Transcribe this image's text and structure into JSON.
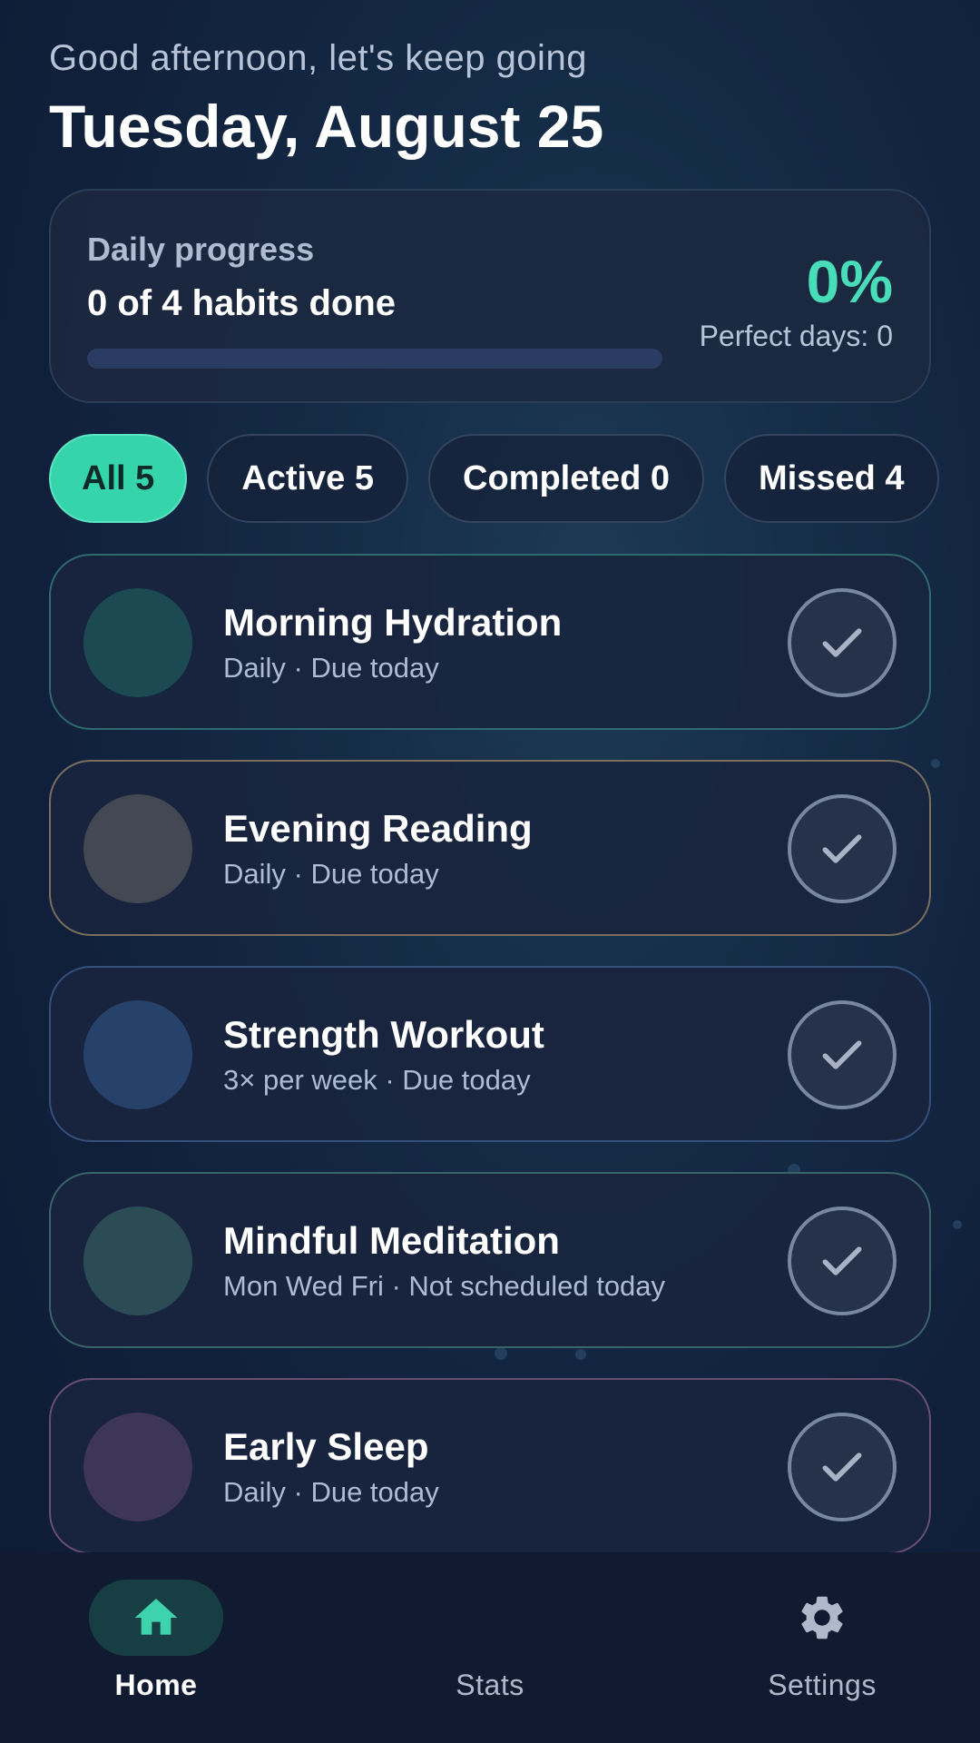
{
  "header": {
    "greeting": "Good afternoon, let's keep going",
    "date": "Tuesday, August 25"
  },
  "progress": {
    "label": "Daily progress",
    "count_text": "0 of 4 habits done",
    "percent_text": "0%",
    "perfect_days": "Perfect days: 0",
    "fill_fraction": 0
  },
  "filters": [
    {
      "label": "All 5",
      "active": true
    },
    {
      "label": "Active 5",
      "active": false
    },
    {
      "label": "Completed 0",
      "active": false
    },
    {
      "label": "Missed 4",
      "active": false
    }
  ],
  "habits": [
    {
      "name": "Morning Hydration",
      "subtitle": "Daily · Due today",
      "avatar_color": "#1d4a52",
      "border_color": "#2e6a70"
    },
    {
      "name": "Evening Reading",
      "subtitle": "Daily · Due today",
      "avatar_color": "#434852",
      "border_color": "#7a6f5e"
    },
    {
      "name": "Strength Workout",
      "subtitle": "3× per week · Due today",
      "avatar_color": "#27426a",
      "border_color": "#34507a"
    },
    {
      "name": "Mindful Meditation",
      "subtitle": "Mon Wed Fri · Not scheduled today",
      "avatar_color": "#2b4c55",
      "border_color": "#3a6468"
    },
    {
      "name": "Early Sleep",
      "subtitle": "Daily · Due today",
      "avatar_color": "#3e3658",
      "border_color": "#6a4e72"
    }
  ],
  "nav": {
    "home": "Home",
    "stats": "Stats",
    "settings": "Settings"
  },
  "colors": {
    "accent": "#36d4ab",
    "icon_active": "#3ed3ad",
    "icon_inactive": "#aeb9cb"
  }
}
